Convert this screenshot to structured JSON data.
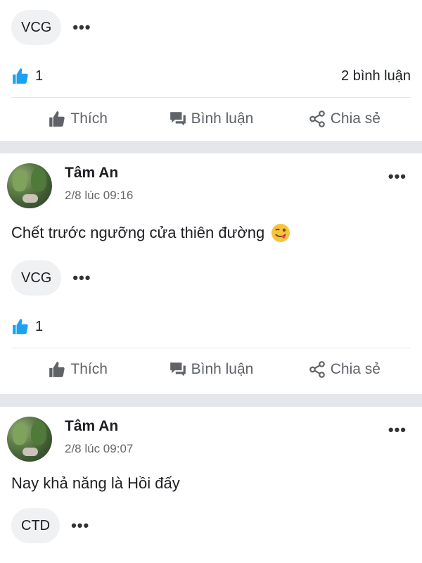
{
  "post0": {
    "tag": "VCG",
    "more": "•••",
    "likes": "1",
    "comments": "2 bình luận"
  },
  "actions": {
    "like": "Thích",
    "comment": "Bình luận",
    "share": "Chia sẻ"
  },
  "post1": {
    "author": "Tâm An",
    "time": "2/8 lúc 09:16",
    "text": "Chết trước ngưỡng cửa thiên đường",
    "emoji": "winking-face-with-tongue",
    "tag": "VCG",
    "more": "•••",
    "likes": "1"
  },
  "post2": {
    "author": "Tâm An",
    "time": "2/8 lúc 09:07",
    "text": "Nay khả năng là Hồi đấy",
    "tag": "CTD",
    "more": "•••"
  },
  "colors": {
    "accent": "#1da1f2",
    "separator": "#e4e6eb",
    "chip": "#f0f1f3",
    "muted": "#65676b"
  }
}
